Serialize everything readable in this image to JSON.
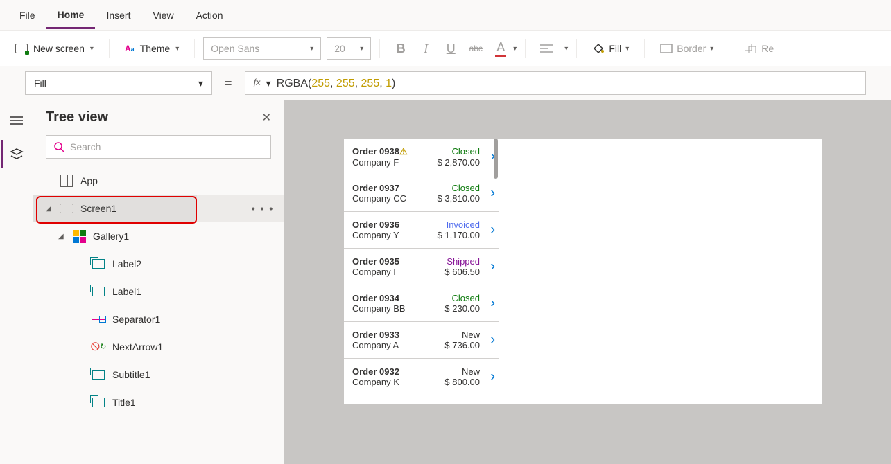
{
  "menubar": {
    "items": [
      "File",
      "Home",
      "Insert",
      "View",
      "Action"
    ],
    "active": "Home"
  },
  "ribbon": {
    "new_screen": "New screen",
    "theme": "Theme",
    "font_name": "Open Sans",
    "font_size": "20",
    "bold": "B",
    "italic": "I",
    "underline": "U",
    "strike": "abc",
    "font_color": "A",
    "fill_label": "Fill",
    "border_label": "Border",
    "reorder_label": "Re"
  },
  "formula": {
    "property": "Fill",
    "fx": "fx",
    "fn": "RGBA",
    "args": [
      "255",
      "255",
      "255",
      "1"
    ]
  },
  "treepanel": {
    "title": "Tree view",
    "search_placeholder": "Search",
    "nodes": {
      "app": "App",
      "screen1": "Screen1",
      "gallery1": "Gallery1",
      "label2": "Label2",
      "label1": "Label1",
      "separator1": "Separator1",
      "nextarrow1": "NextArrow1",
      "subtitle1": "Subtitle1",
      "title1": "Title1"
    },
    "more": "• • •"
  },
  "gallery": [
    {
      "order": "Order 0938",
      "warn": true,
      "status": "Closed",
      "company": "Company F",
      "amount": "$ 2,870.00"
    },
    {
      "order": "Order 0937",
      "warn": false,
      "status": "Closed",
      "company": "Company CC",
      "amount": "$ 3,810.00"
    },
    {
      "order": "Order 0936",
      "warn": false,
      "status": "Invoiced",
      "company": "Company Y",
      "amount": "$ 1,170.00"
    },
    {
      "order": "Order 0935",
      "warn": false,
      "status": "Shipped",
      "company": "Company I",
      "amount": "$ 606.50"
    },
    {
      "order": "Order 0934",
      "warn": false,
      "status": "Closed",
      "company": "Company BB",
      "amount": "$ 230.00"
    },
    {
      "order": "Order 0933",
      "warn": false,
      "status": "New",
      "company": "Company A",
      "amount": "$ 736.00"
    },
    {
      "order": "Order 0932",
      "warn": false,
      "status": "New",
      "company": "Company K",
      "amount": "$ 800.00"
    }
  ]
}
